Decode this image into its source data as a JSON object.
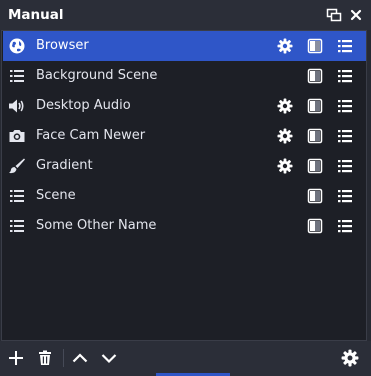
{
  "dock": {
    "title": "Manual"
  },
  "sources": [
    {
      "label": "Browser",
      "icon": "globe-icon",
      "has_settings": true,
      "selected": true
    },
    {
      "label": "Background Scene",
      "icon": "list-icon",
      "has_settings": false,
      "selected": false
    },
    {
      "label": "Desktop Audio",
      "icon": "speaker-icon",
      "has_settings": true,
      "selected": false
    },
    {
      "label": "Face Cam Newer",
      "icon": "camera-icon",
      "has_settings": true,
      "selected": false
    },
    {
      "label": "Gradient",
      "icon": "brush-icon",
      "has_settings": true,
      "selected": false
    },
    {
      "label": "Scene",
      "icon": "list-icon",
      "has_settings": false,
      "selected": false
    },
    {
      "label": "Some Other Name",
      "icon": "list-icon",
      "has_settings": false,
      "selected": false
    }
  ],
  "colors": {
    "selection": "#2f56c8",
    "panel_bg": "#1d1f26",
    "dock_bg": "#2b2e38"
  }
}
